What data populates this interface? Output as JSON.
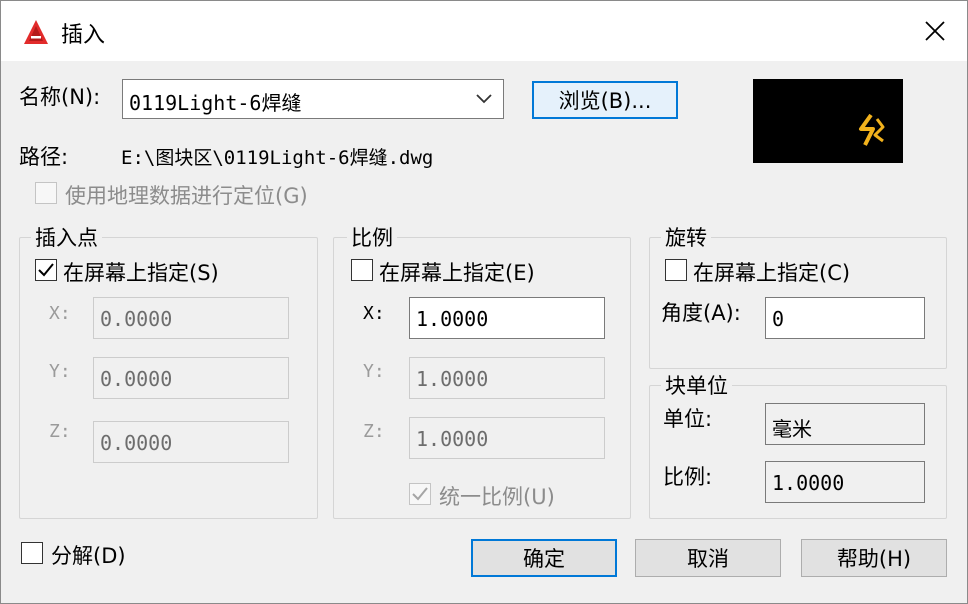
{
  "window": {
    "title": "插入",
    "close_glyph": "✕"
  },
  "name": {
    "label": "名称(N):",
    "value": "0119Light-6焊缝",
    "browse_label": "浏览(B)..."
  },
  "path": {
    "label": "路径:",
    "value": "E:\\图块区\\0119Light-6焊缝.dwg"
  },
  "geo": {
    "label": "使用地理数据进行定位(G)",
    "checked": false,
    "enabled": false
  },
  "insertion_point": {
    "title": "插入点",
    "specify_label": "在屏幕上指定(S)",
    "specify_checked": true,
    "x_label": "X:",
    "x_value": "0.0000",
    "y_label": "Y:",
    "y_value": "0.0000",
    "z_label": "Z:",
    "z_value": "0.0000"
  },
  "scale": {
    "title": "比例",
    "specify_label": "在屏幕上指定(E)",
    "specify_checked": false,
    "x_label": "X:",
    "x_value": "1.0000",
    "y_label": "Y:",
    "y_value": "1.0000",
    "z_label": "Z:",
    "z_value": "1.0000",
    "uniform_label": "统一比例(U)",
    "uniform_checked": true
  },
  "rotation": {
    "title": "旋转",
    "specify_label": "在屏幕上指定(C)",
    "specify_checked": false,
    "angle_label": "角度(A):",
    "angle_value": "0"
  },
  "block_unit": {
    "title": "块单位",
    "unit_label": "单位:",
    "unit_value": "毫米",
    "factor_label": "比例:",
    "factor_value": "1.0000"
  },
  "explode": {
    "label": "分解(D)",
    "checked": false
  },
  "buttons": {
    "ok": "确定",
    "cancel": "取消",
    "help": "帮助(H)"
  },
  "colors": {
    "accent": "#0078d7",
    "app_icon": "#e22b2b",
    "preview_bg": "#000000",
    "preview_symbol": "#f2b21c"
  },
  "icons": {
    "app": "autocad-logo-icon",
    "preview": "weld-symbol-icon",
    "dropdown": "chevron-down-icon",
    "check": "checkmark-icon"
  }
}
